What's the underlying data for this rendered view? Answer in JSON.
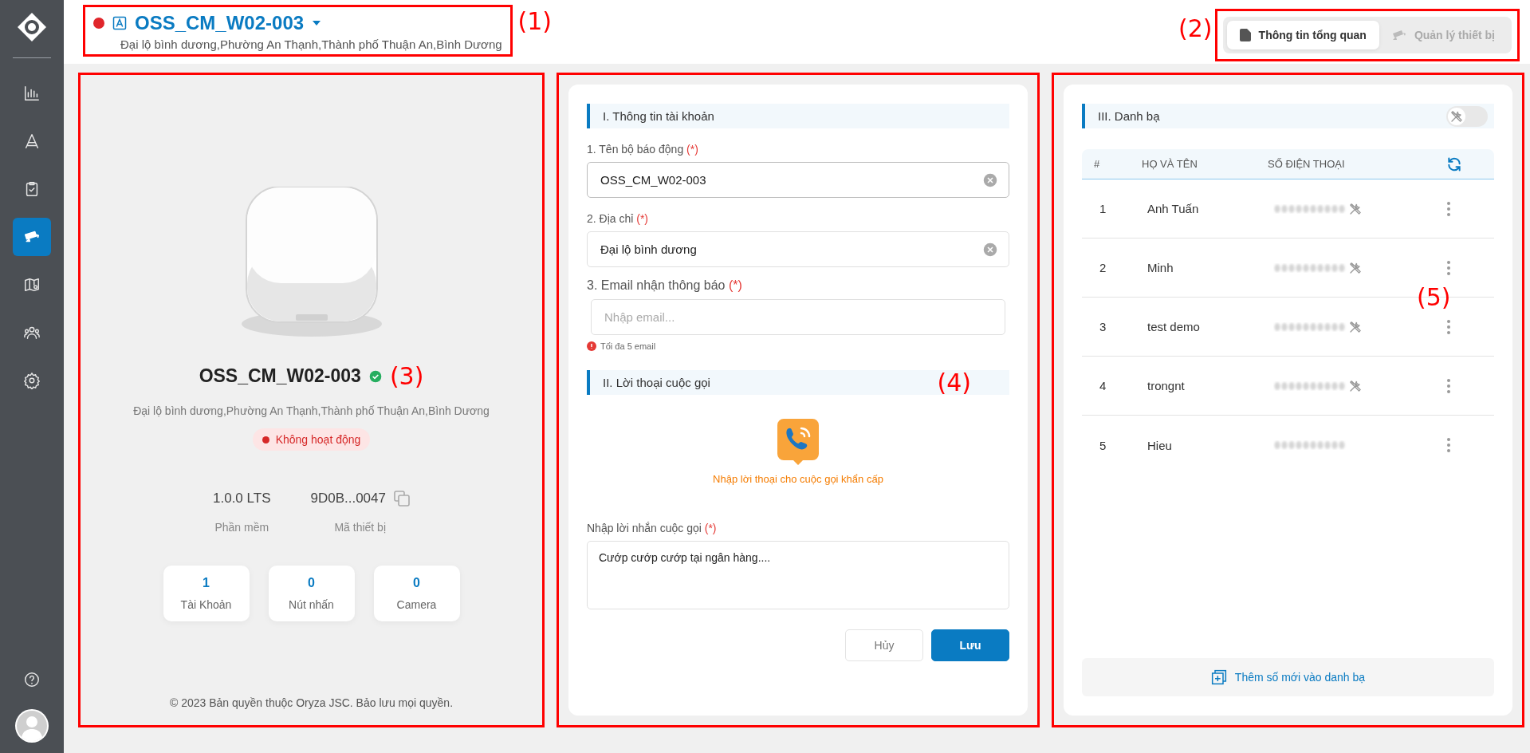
{
  "sidebar": {
    "items": [
      {
        "kind": "chart",
        "selected": false
      },
      {
        "kind": "letter",
        "selected": false
      },
      {
        "kind": "clipboard",
        "selected": false
      },
      {
        "kind": "camera",
        "selected": true
      },
      {
        "kind": "map",
        "selected": false
      },
      {
        "kind": "users",
        "selected": false
      },
      {
        "kind": "settings",
        "selected": false
      }
    ]
  },
  "header": {
    "marker": "(1)",
    "active": false,
    "name": "OSS_CM_W02-003",
    "address": "Đại lộ bình dương,Phường An Thạnh,Thành phố Thuận An,Bình Dương"
  },
  "tabs": {
    "marker": "(2)",
    "items": [
      {
        "label": "Thông tin tổng quan",
        "selected": true
      },
      {
        "label": "Quản lý thiết bị",
        "selected": false
      }
    ]
  },
  "device_panel": {
    "marker": "(3)",
    "name": "OSS_CM_W02-003",
    "verified": true,
    "address": "Đại lộ bình dương,Phường An Thạnh,Thành phố Thuận An,Bình Dương",
    "status": {
      "label": "Không hoạt động",
      "active": false
    },
    "info": [
      {
        "value": "1.0.0 LTS",
        "label": "Phần mềm",
        "copyable": false
      },
      {
        "value": "9D0B...0047",
        "label": "Mã thiết bị",
        "copyable": true
      }
    ],
    "stats": [
      {
        "value": "1",
        "label": "Tài Khoản"
      },
      {
        "value": "0",
        "label": "Nút nhấn"
      },
      {
        "value": "0",
        "label": "Camera"
      }
    ],
    "footer": "© 2023 Bản quyền thuộc Oryza JSC. Bảo lưu mọi quyền."
  },
  "form_panel": {
    "marker": "(4)",
    "section_1": "I. Thông tin tài khoản",
    "fields": [
      {
        "kind": "clearable",
        "label": "1. Tên bộ báo động",
        "required_mark": "(*)",
        "value": "OSS_CM_W02-003"
      },
      {
        "kind": "clearable",
        "label": "2. Địa chỉ",
        "required_mark": "(*)",
        "value": "Đại lộ bình dương"
      },
      {
        "kind": "email",
        "label": "3. Email nhận thông báo",
        "required_mark": "(*)",
        "placeholder": "Nhập email...",
        "hint": "Tối đa 5 email"
      }
    ],
    "section_2": "II. Lời thoại cuộc gọi",
    "call_prompt": "Nhập lời thoại cho cuộc gọi khẩn cấp",
    "message": {
      "label": "Nhập lời nhắn cuộc gọi",
      "required_mark": "(*)",
      "value": "Cướp cướp cướp tại ngân hàng...."
    },
    "buttons": [
      {
        "label": "Hủy",
        "kind": "secondary"
      },
      {
        "label": "Lưu",
        "kind": "primary"
      }
    ]
  },
  "contacts_panel": {
    "marker": "(5)",
    "title": "III. Danh bạ",
    "toggle_on": false,
    "columns": [
      "#",
      "HỌ VÀ TÊN",
      "SỐ ĐIỆN THOẠI"
    ],
    "rows": [
      {
        "index": "1",
        "name": "Anh Tuấn",
        "tool": true
      },
      {
        "index": "2",
        "name": "Minh",
        "tool": true
      },
      {
        "index": "3",
        "name": "test demo",
        "tool": true
      },
      {
        "index": "4",
        "name": "trongnt",
        "tool": true
      },
      {
        "index": "5",
        "name": "Hieu",
        "tool": false
      }
    ],
    "add_button": "Thêm số mới vào danh bạ"
  }
}
